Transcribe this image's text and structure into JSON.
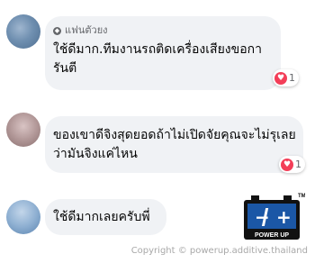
{
  "comments": [
    {
      "badge": "แฟนตัวยง",
      "text": "ใช้ดีมาก.ทีมงานรถติดเครื่องเสียงขอการันตี",
      "reaction_count": "1"
    },
    {
      "text": "ของเขาดีจิงสุดยอดถ้าไม่เปิดจัยคุณจะไม่รุเลยว่ามันจิงแค่ไหน",
      "reaction_count": "1"
    },
    {
      "text": "ใช้ดีมากเลยครับพี่"
    }
  ],
  "logo": {
    "brand_text": "POWER UP",
    "tm": "TM",
    "minus": "−",
    "plus": "+"
  },
  "watermark": "Copyright © powerup.additive.thailand",
  "colors": {
    "bubble": "#f0f2f5",
    "heart": "#f33e58",
    "logo_blue": "#1b57a6"
  }
}
